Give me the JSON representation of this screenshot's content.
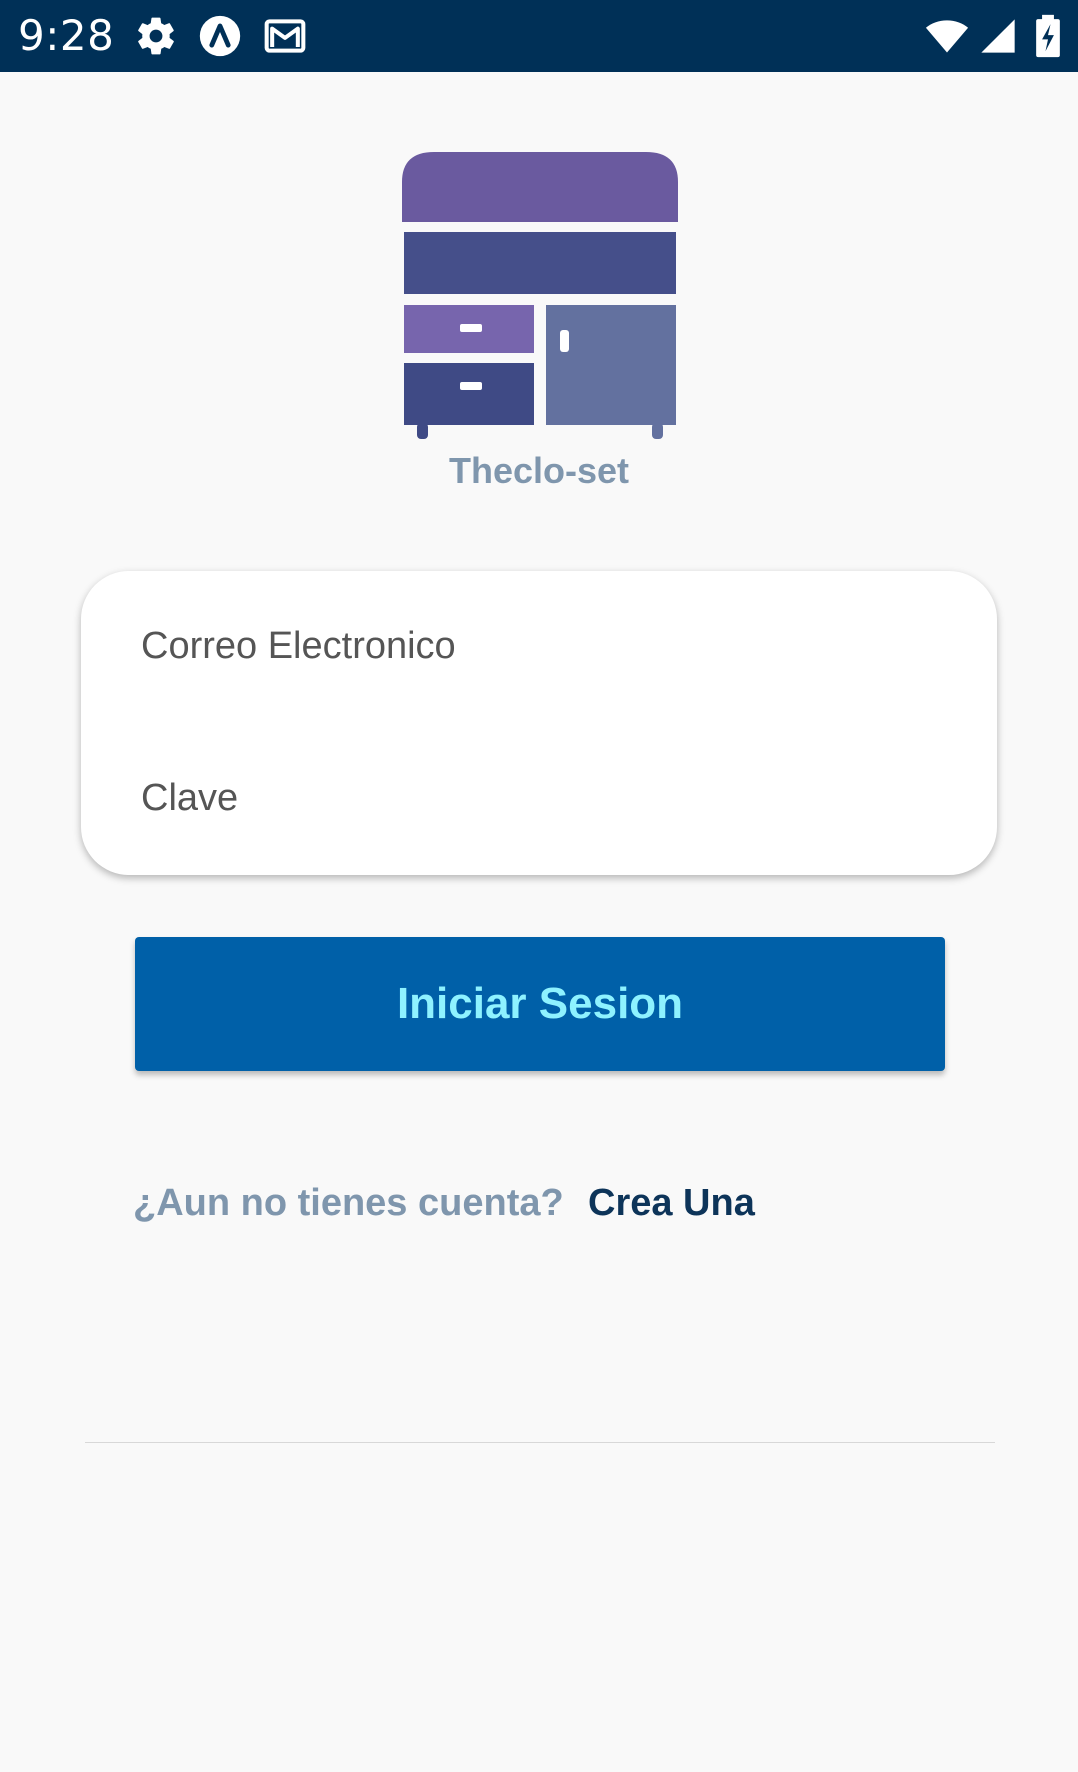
{
  "status_bar": {
    "time": "9:28",
    "icons": [
      "settings-gear-icon",
      "app-a-icon",
      "gmail-icon",
      "wifi-icon",
      "cell-signal-icon",
      "battery-charging-icon"
    ]
  },
  "logo": {
    "icon": "wardrobe-icon",
    "app_name": "Theclo-set"
  },
  "login_form": {
    "email_placeholder": "Correo Electronico",
    "email_value": "",
    "password_placeholder": "Clave",
    "password_value": ""
  },
  "login_button": {
    "label": "Iniciar Sesion"
  },
  "register": {
    "question": "¿Aun no tienes cuenta?",
    "link_label": "Crea Una"
  },
  "colors": {
    "status_bar": "#003057",
    "background": "#f9f9f9",
    "button": "#0060a8",
    "button_text": "#8ef2ff",
    "muted_text": "#7f96ad",
    "link_text": "#0d3459"
  }
}
